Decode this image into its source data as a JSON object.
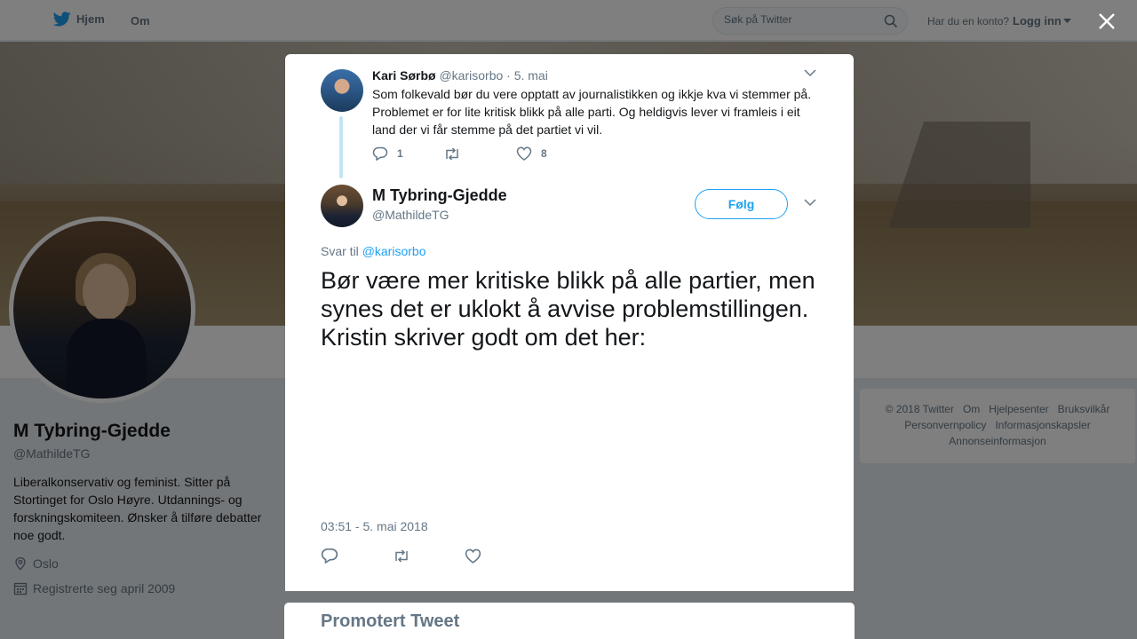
{
  "nav": {
    "home_label": "Hjem",
    "about_label": "Om",
    "search_placeholder": "Søk på Twitter",
    "account_question": "Har du en konto?",
    "login_label": "Logg inn"
  },
  "profile": {
    "name": "M Tybring-Gjedde",
    "handle": "@MathildeTG",
    "bio": "Liberalkonservativ og feminist. Sitter på Stortinget for Oslo Høyre. Utdannings- og forskningskomiteen. Ønsker å tilføre debatter noe godt.",
    "location": "Oslo",
    "joined": "Registrerte seg april 2009"
  },
  "footer": {
    "links": [
      "© 2018 Twitter",
      "Om",
      "Hjelpesenter",
      "Bruksvilkår",
      "Personvernpolicy",
      "Informasjonskapsler",
      "Annonseinformasjon"
    ]
  },
  "parent_tweet": {
    "name": "Kari Sørbø",
    "handle": "@karisorbo",
    "date": "· 5. mai",
    "text": "Som folkevald bør du vere opptatt av  journalistikken og ikkje kva vi stemmer på. Problemet er for lite kritisk blikk på alle parti. Og heldigvis lever vi framleis i eit land der vi får stemme på det partiet vi vil.",
    "reply_count": "1",
    "like_count": "8"
  },
  "main_tweet": {
    "name": "M Tybring-Gjedde",
    "handle": "@MathildeTG",
    "follow_label": "Følg",
    "reply_prefix": "Svar til",
    "reply_handle": "@karisorbo",
    "text": "Bør være mer kritiske blikk på alle partier, men synes det er uklokt å avvise problemstillingen. Kristin skriver godt om det her:",
    "timestamp": "03:51 - 5. mai 2018"
  },
  "promoted": {
    "title": "Promotert Tweet"
  },
  "colors": {
    "accent": "#1da1f2",
    "secondary_text": "#657786",
    "thread_line": "#c4e4f7"
  },
  "icons": [
    "twitter-bird-icon",
    "search-icon",
    "caret-down-icon",
    "close-icon",
    "location-icon",
    "calendar-icon",
    "reply-icon",
    "retweet-icon",
    "like-icon"
  ]
}
